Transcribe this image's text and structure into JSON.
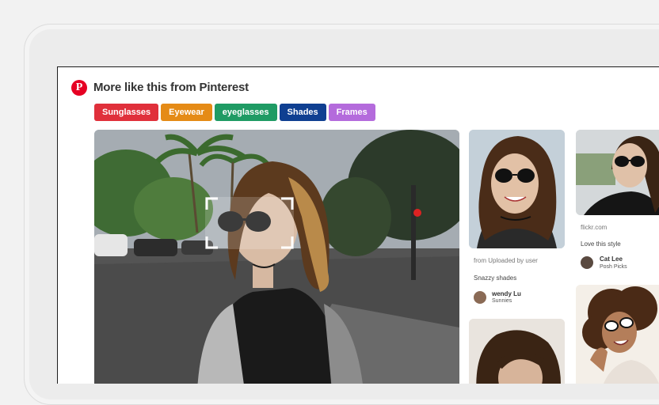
{
  "header": {
    "title": "More like this from Pinterest",
    "logo": "P"
  },
  "tags": [
    {
      "label": "Sunglasses",
      "color": "#e0303b"
    },
    {
      "label": "Eyewear",
      "color": "#e58b16"
    },
    {
      "label": "eyeglasses",
      "color": "#1f9b64"
    },
    {
      "label": "Shades",
      "color": "#0f3f91"
    },
    {
      "label": "Frames",
      "color": "#b46bdc"
    }
  ],
  "pins": {
    "col1": {
      "source": "from Uploaded by user",
      "description": "Snazzy shades",
      "user": "wendy Lu",
      "board": "Sunnies"
    },
    "col2": {
      "source": "flickr.com",
      "description": "Love this style",
      "user": "Cat Lee",
      "board": "Posh Picks"
    }
  }
}
